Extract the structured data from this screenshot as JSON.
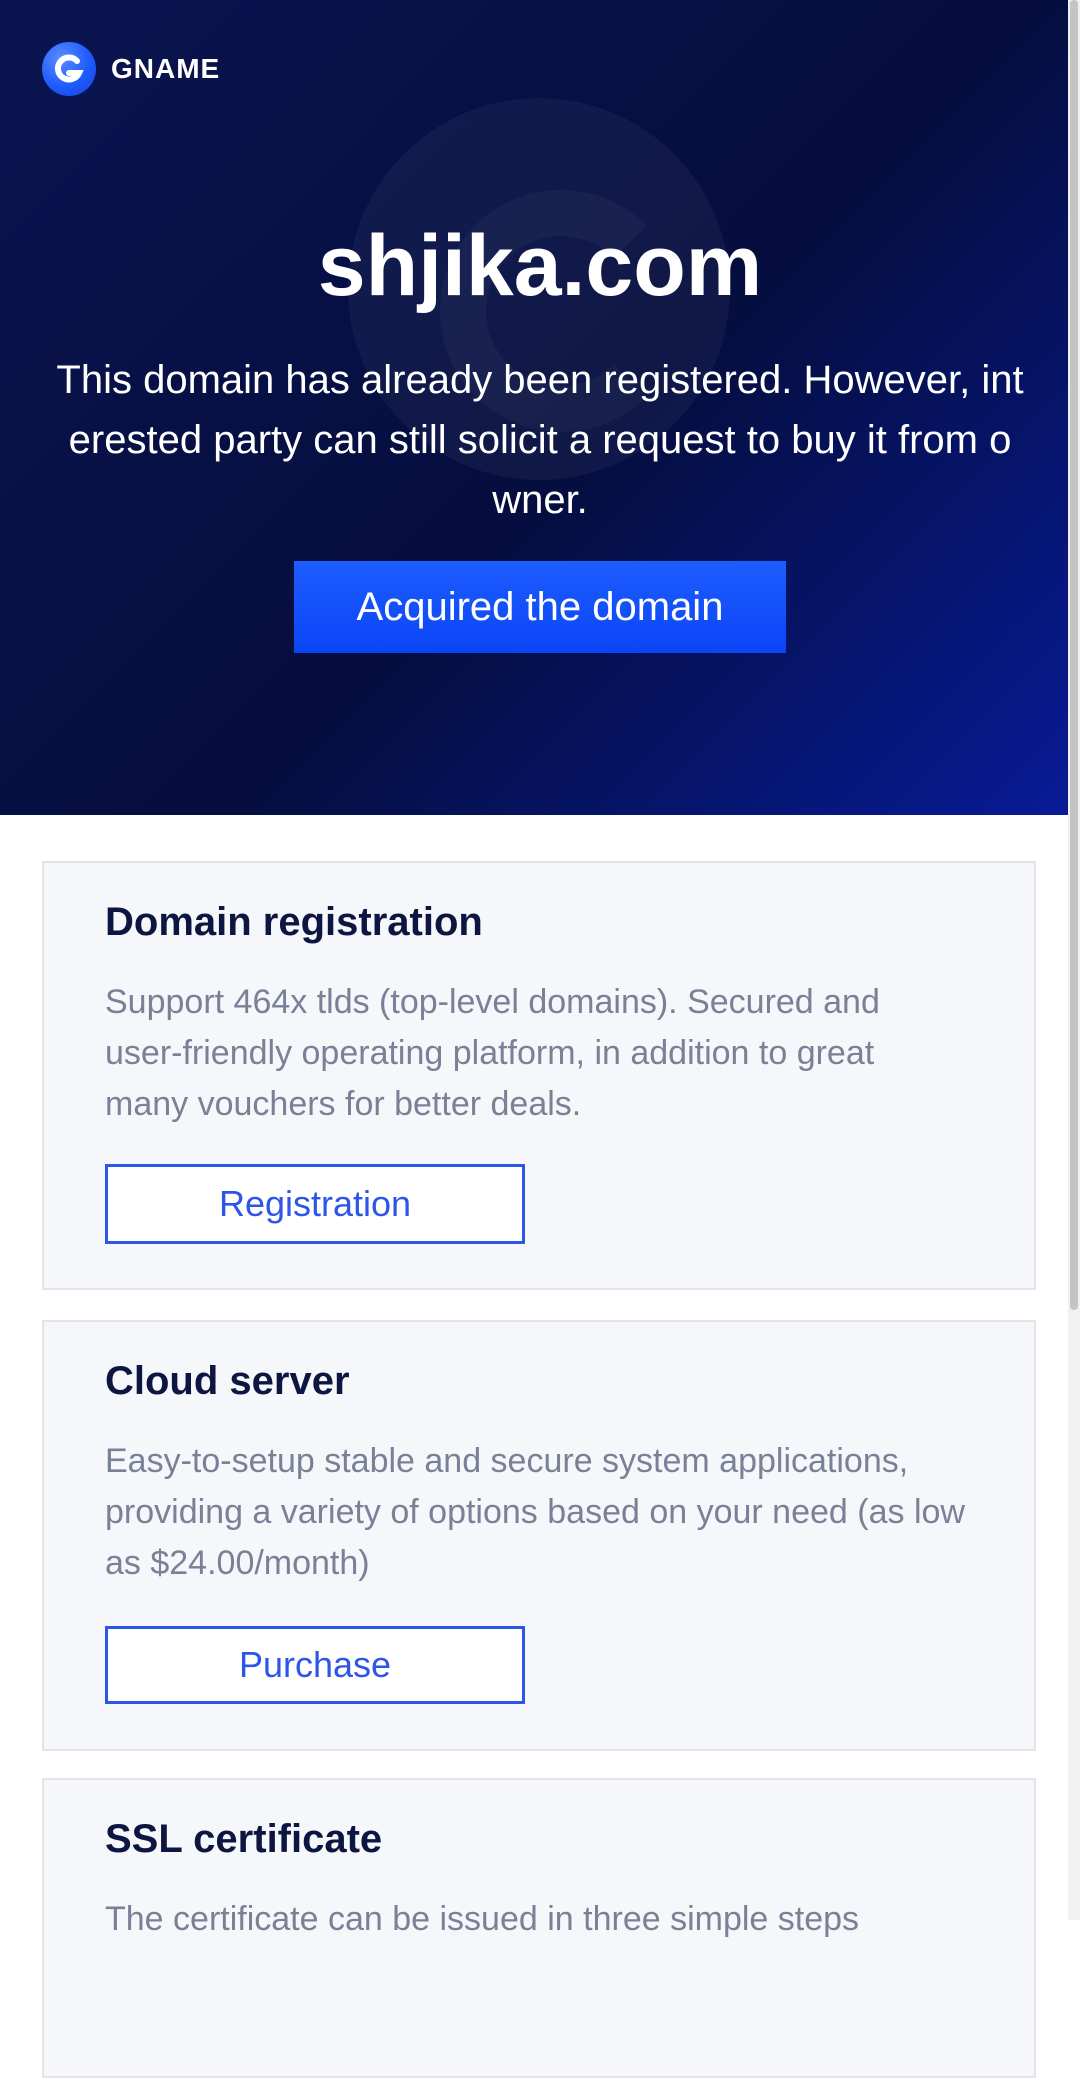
{
  "brand": {
    "logo_name": "GNAME",
    "logo_icon": "gname-g-logo-icon"
  },
  "hero": {
    "domain": "shjika.com",
    "message": "This domain has already been registered. However, interested party can still solicit a request to buy it from owner.",
    "button_label": "Acquired the domain"
  },
  "services": [
    {
      "title": "Domain registration",
      "description": "Support 464x tlds (top-level domains). Secured and user-friendly operating platform, in addition to great many vouchers for better deals.",
      "button_label": "Registration"
    },
    {
      "title": "Cloud server",
      "description": "Easy-to-setup stable and secure system applications, providing a variety of options based on your need (as low as $24.00/month)",
      "button_label": "Purchase"
    },
    {
      "title": "SSL certificate",
      "description": "The certificate can be issued in three simple steps"
    }
  ],
  "colors": {
    "hero_background": "#050e3e",
    "primary_button": "#0a45f5",
    "accent": "#2d55e8",
    "card_background": "#f6f7fb"
  }
}
